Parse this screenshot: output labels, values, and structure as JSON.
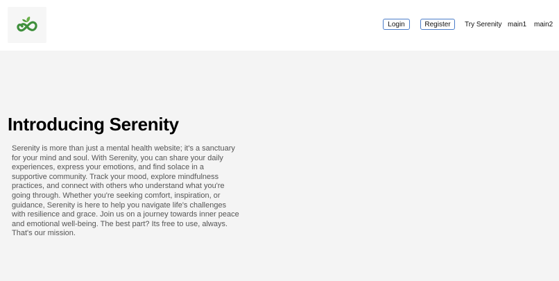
{
  "header": {
    "logo_icon": "infinity-leaf-icon",
    "nav": {
      "login_label": "Login",
      "register_label": "Register",
      "try_label": "Try Serenity",
      "main1_label": "main1",
      "main2_label": "main2"
    }
  },
  "hero": {
    "title": "Introducing Serenity",
    "description": "Serenity is more than just a mental health website; it's a sanctuary for your mind and soul. With Serenity, you can share your daily experiences, express your emotions, and find solace in a supportive community. Track your mood, explore mindfulness practices, and connect with others who understand what you're going through. Whether you're seeking comfort, inspiration, or guidance, Serenity is here to help you navigate life's challenges with resilience and grace. Join us on a journey towards inner peace and emotional well-being. The best part? Its free to use, always. That's our mission."
  },
  "colors": {
    "brand_green": "#3f8f3c",
    "button_border": "#4a7cc9",
    "page_background": "#f4f4f4"
  }
}
